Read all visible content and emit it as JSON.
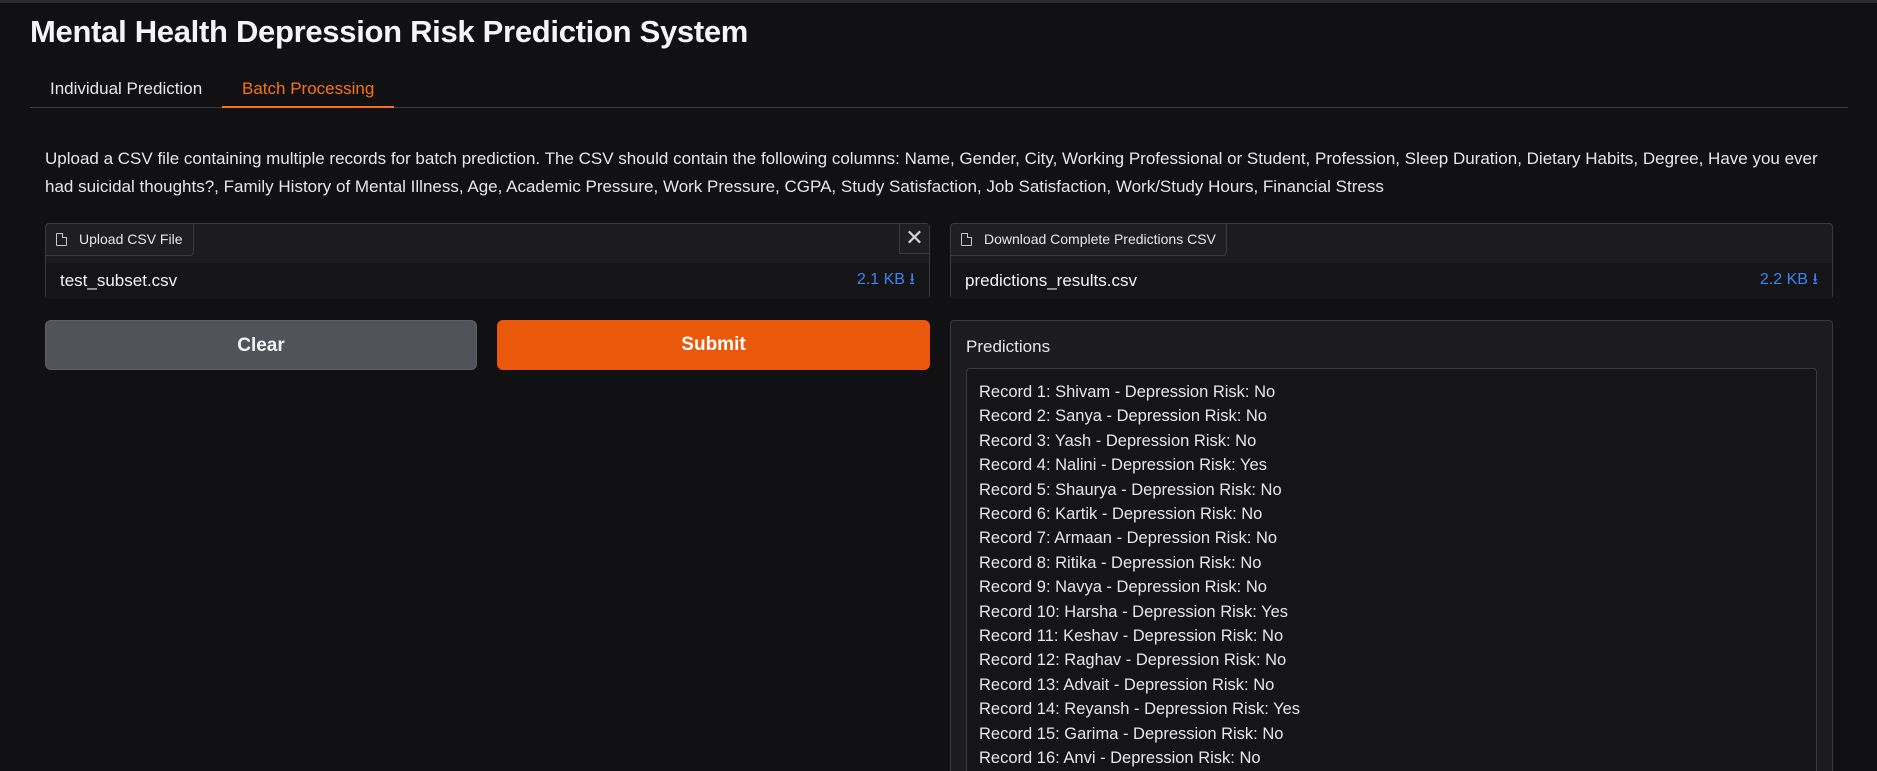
{
  "app": {
    "title": "Mental Health Depression Risk Prediction System"
  },
  "tabs": [
    {
      "label": "Individual Prediction",
      "active": false
    },
    {
      "label": "Batch Processing",
      "active": true
    }
  ],
  "description": "Upload a CSV file containing multiple records for batch prediction. The CSV should contain the following columns: Name, Gender, City, Working Professional or Student, Profession, Sleep Duration, Dietary Habits, Degree, Have you ever had suicidal thoughts?, Family History of Mental Illness, Age, Academic Pressure, Work Pressure, CGPA, Study Satisfaction, Job Satisfaction, Work/Study Hours, Financial Stress",
  "upload": {
    "label": "Upload CSV File",
    "file_name": "test_subset.csv",
    "file_size": "2.1 KB ⭳",
    "close_glyph": "✕"
  },
  "download": {
    "label": "Download Complete Predictions CSV",
    "file_name": "predictions_results.csv",
    "file_size": "2.2 KB ⭳"
  },
  "buttons": {
    "clear": "Clear",
    "submit": "Submit"
  },
  "predictions": {
    "label": "Predictions",
    "lines": [
      "Record 1: Shivam - Depression Risk: No",
      "Record 2: Sanya - Depression Risk: No",
      "Record 3: Yash - Depression Risk: No",
      "Record 4: Nalini - Depression Risk: Yes",
      "Record 5: Shaurya - Depression Risk: No",
      "Record 6: Kartik - Depression Risk: No",
      "Record 7: Armaan - Depression Risk: No",
      "Record 8: Ritika - Depression Risk: No",
      "Record 9: Navya - Depression Risk: No",
      "Record 10: Harsha - Depression Risk: Yes",
      "Record 11: Keshav - Depression Risk: No",
      "Record 12: Raghav - Depression Risk: No",
      "Record 13: Advait - Depression Risk: No",
      "Record 14: Reyansh - Depression Risk: Yes",
      "Record 15: Garima - Depression Risk: No",
      "Record 16: Anvi - Depression Risk: No"
    ]
  },
  "colors": {
    "accent": "#f97316",
    "submit_bg": "#ea580c",
    "link": "#3b82f6",
    "clear_bg": "#52525b"
  }
}
